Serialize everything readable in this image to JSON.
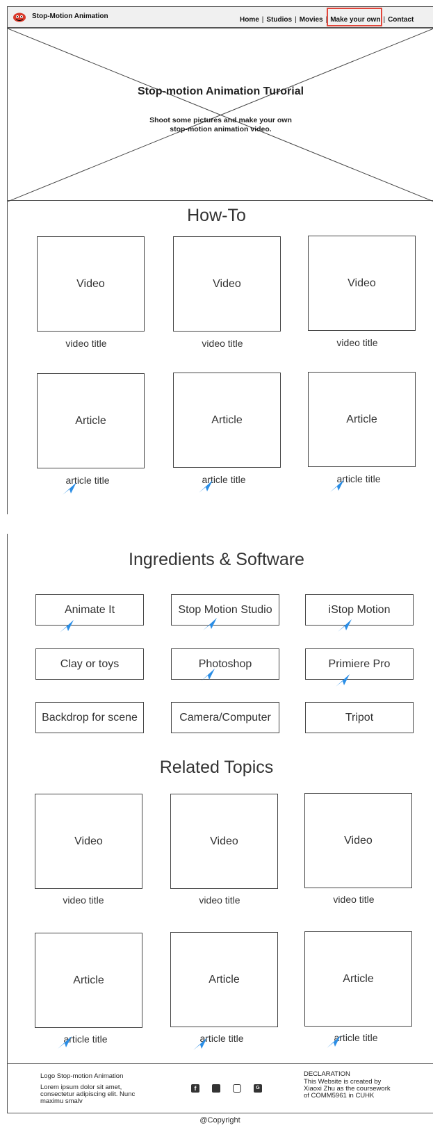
{
  "header": {
    "brand": "Stop-Motion Animation",
    "nav": [
      "Home",
      "Studios",
      "Movies",
      "Make your own",
      "Contact"
    ]
  },
  "hero": {
    "title": "Stop-motion Animation Turorial",
    "subtitle_line1": "Shoot some pictures and make your own",
    "subtitle_line2": "stop-motion animation video."
  },
  "howto": {
    "heading": "How-To",
    "videos": [
      {
        "box": "Video",
        "title": "video title"
      },
      {
        "box": "Video",
        "title": "video title"
      },
      {
        "box": "Video",
        "title": "video title"
      }
    ],
    "articles": [
      {
        "box": "Article",
        "title": "article title"
      },
      {
        "box": "Article",
        "title": "article title"
      },
      {
        "box": "Article",
        "title": "article title"
      }
    ]
  },
  "ingredients": {
    "heading": "Ingredients & Software",
    "items": [
      "Animate It",
      "Stop Motion Studio",
      "iStop Motion",
      "Clay or toys",
      "Photoshop",
      "Primiere Pro",
      "Backdrop for scene",
      "Camera/Computer",
      "Tripot"
    ]
  },
  "related": {
    "heading": "Related Topics",
    "videos": [
      {
        "box": "Video",
        "title": "video title"
      },
      {
        "box": "Video",
        "title": "video title"
      },
      {
        "box": "Video",
        "title": "video title"
      }
    ],
    "articles": [
      {
        "box": "Article",
        "title": "article title"
      },
      {
        "box": "Article",
        "title": "article title"
      },
      {
        "box": "Article",
        "title": "article title"
      }
    ]
  },
  "footer": {
    "logo_line": "Logo Stop-motion Animation",
    "lorem": [
      "Lorem ipsum dolor sit amet,",
      "consectetur adipiscing elit. Nunc",
      "maximu smalv"
    ],
    "social_icons": [
      "facebook-icon",
      "twitter-icon",
      "instagram-icon",
      "google-plus-icon"
    ],
    "declaration_title": "DECLARATION",
    "declaration": [
      "This Website is created by",
      "Xiaoxi Zhu as the coursework",
      "of COMM5961 in CUHK"
    ],
    "copyright": "@Copyright"
  },
  "colors": {
    "highlight": "#e0453a",
    "cursor": "#2b8ee6",
    "header_bg": "#f0f0f0"
  }
}
